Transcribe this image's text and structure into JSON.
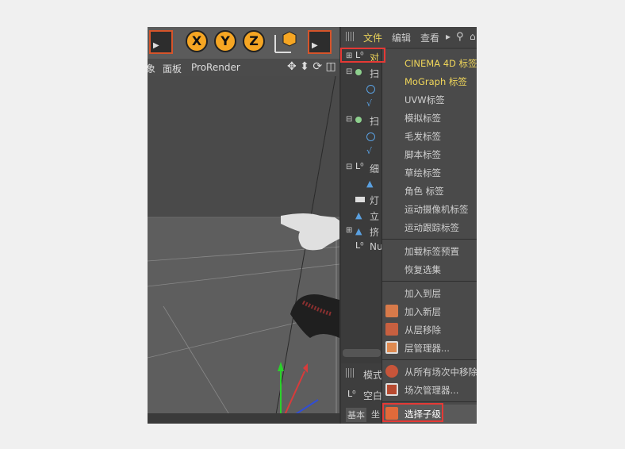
{
  "toolbar": {
    "axes": [
      "X",
      "Y",
      "Z"
    ],
    "clapper_label": "▶"
  },
  "viewport_menu": {
    "items": [
      "面板",
      "ProRender"
    ],
    "cut_item": "象"
  },
  "right_panel": {
    "menu": {
      "file": "文件",
      "edit": "编辑",
      "view": "查看"
    },
    "tree_labels": [
      "对",
      "扫",
      "扫",
      "细",
      "灯",
      "立",
      "挤",
      "Nu"
    ],
    "attr_mode_label": "模式",
    "attr_object_label": "空白",
    "attr_tabs": [
      "基本",
      "坐"
    ]
  },
  "context_menu": {
    "items": [
      {
        "label": "CINEMA 4D 标签",
        "highlight": true
      },
      {
        "label": "MoGraph 标签",
        "highlight": true
      },
      {
        "label": "UVW标签"
      },
      {
        "label": "模拟标签"
      },
      {
        "label": "毛发标签"
      },
      {
        "label": "脚本标签"
      },
      {
        "label": "草绘标签"
      },
      {
        "label": "角色 标签"
      },
      {
        "label": "运动摄像机标签"
      },
      {
        "label": "运动跟踪标签"
      },
      {
        "label": "加载标签预置"
      },
      {
        "label": "恢复选集"
      },
      {
        "label": "加入到层"
      },
      {
        "label": "加入新层"
      },
      {
        "label": "从层移除"
      },
      {
        "label": "层管理器..."
      },
      {
        "label": "从所有场次中移除"
      },
      {
        "label": "场次管理器..."
      },
      {
        "label": "选择子级"
      }
    ]
  },
  "colors": {
    "highlight_text": "#f0d65a",
    "annotation_red": "#e53935",
    "axis_orange": "#f6a623"
  }
}
